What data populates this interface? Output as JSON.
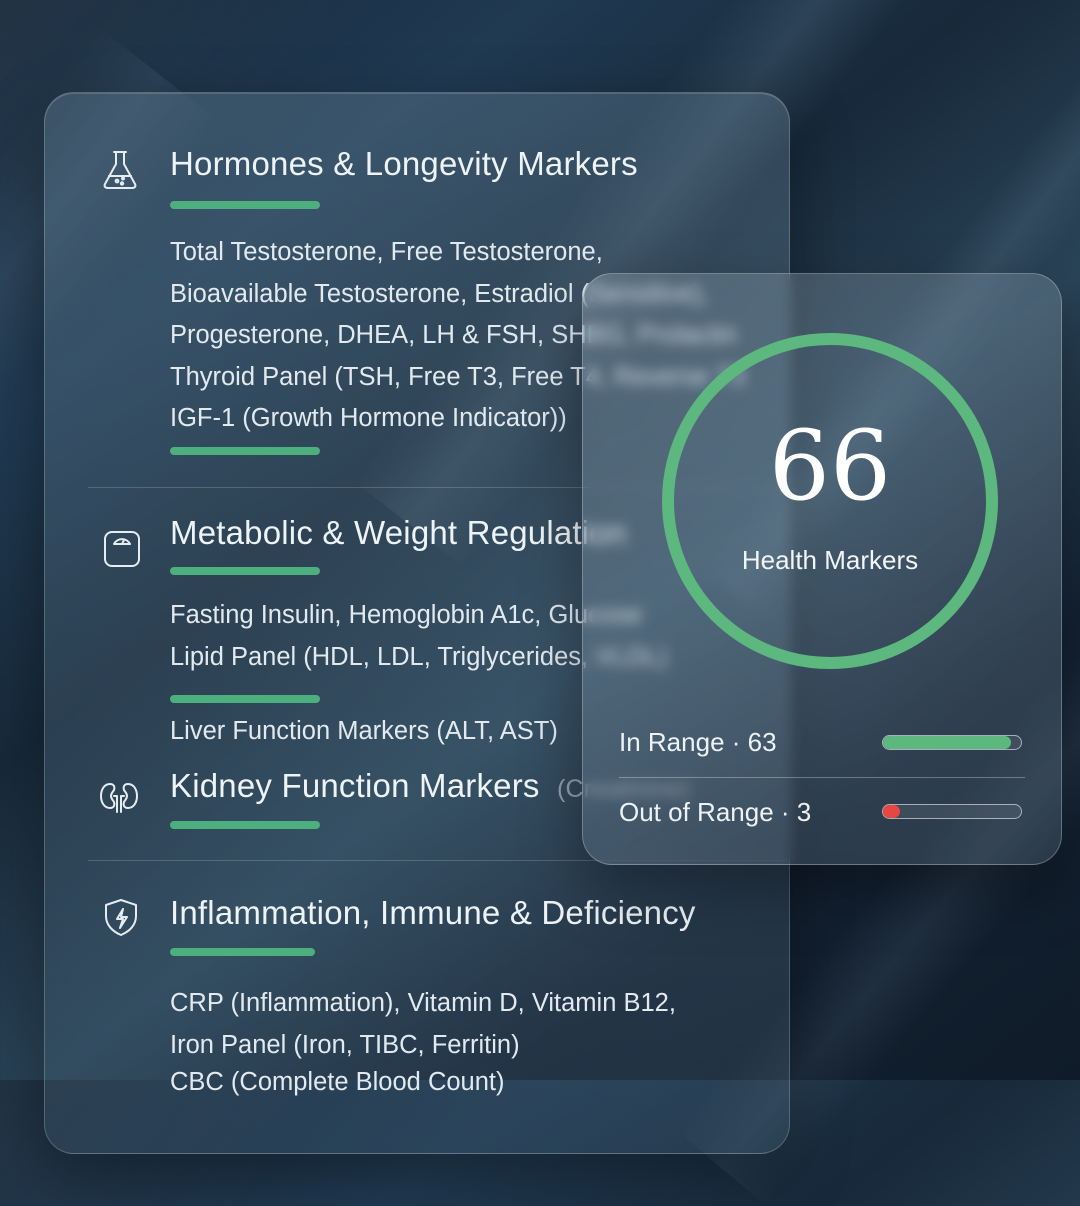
{
  "sections": [
    {
      "title": "Hormones & Longevity Markers",
      "icon": "flask-icon",
      "lines": [
        "Total Testosterone, Free Testosterone,",
        "Bioavailable Testosterone, Estradiol (Sensitive),",
        "Progesterone, DHEA, LH & FSH, SHBG, Prolactin",
        "Thyroid Panel (TSH, Free T3, Free T4, Reverse T3",
        "IGF-1 (Growth Hormone Indicator))"
      ]
    },
    {
      "title": "Metabolic & Weight Regulation",
      "icon": "scale-icon",
      "lines": [
        "Fasting Insulin, Hemoglobin A1c, Glucose",
        "Lipid Panel (HDL, LDL, Triglycerides, VLDL)"
      ],
      "extra_line": "Liver Function Markers (ALT, AST)"
    },
    {
      "title": "Kidney Function Markers",
      "title_suffix": "(Creatinine)",
      "icon": "kidneys-icon"
    },
    {
      "title": "Inflammation, Immune & Deficiency",
      "icon": "shield-bolt-icon",
      "lines": [
        "CRP (Inflammation), Vitamin D, Vitamin B12,",
        "Iron Panel (Iron, TIBC, Ferritin)",
        "CBC (Complete Blood Count)"
      ]
    }
  ],
  "summary": {
    "total": "66",
    "total_label": "Health Markers",
    "in_range_label": "In Range · 63",
    "in_range_fraction": 0.93,
    "out_of_range_label": "Out of Range · 3",
    "out_of_range_fraction": 0.07
  },
  "colors": {
    "accent_green": "#4caf7d",
    "ring_green": "#5cb87e",
    "alert_red": "#e84545"
  }
}
